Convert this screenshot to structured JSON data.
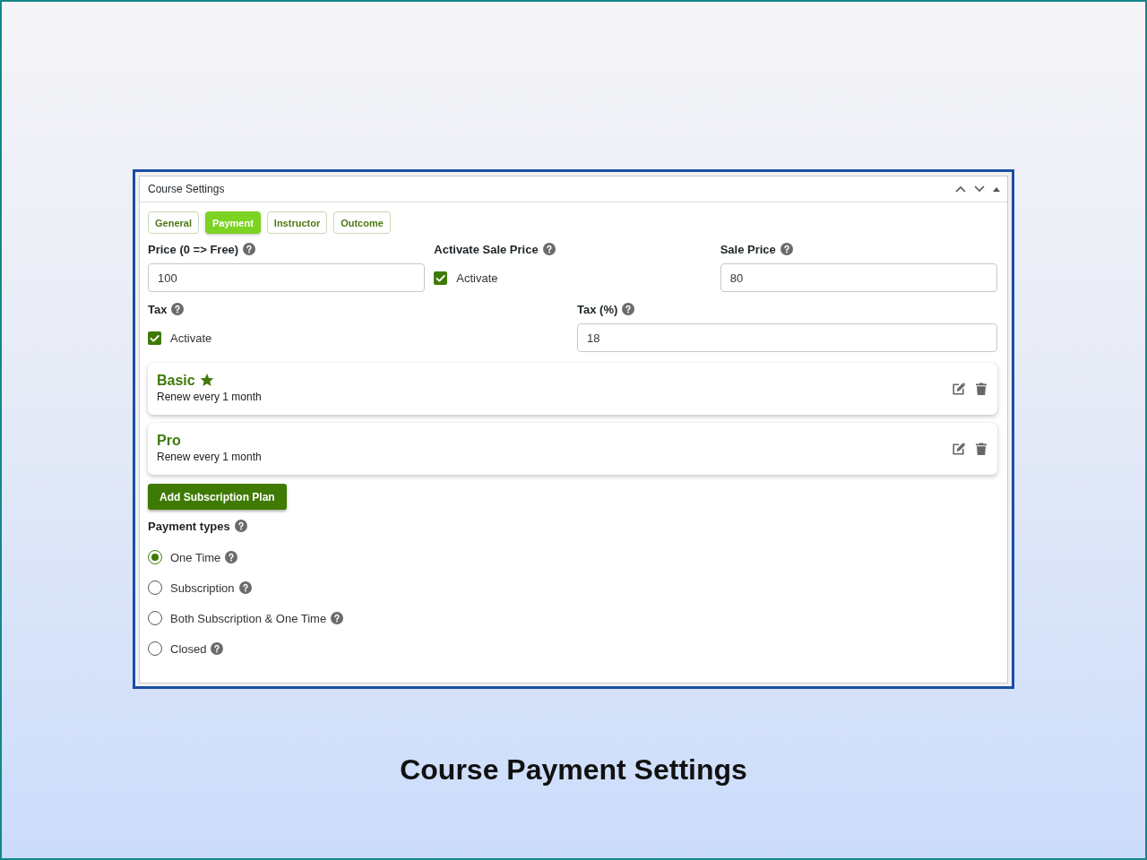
{
  "panel": {
    "title": "Course Settings"
  },
  "tabs": [
    {
      "label": "General",
      "selected": false
    },
    {
      "label": "Payment",
      "selected": true
    },
    {
      "label": "Instructor",
      "selected": false
    },
    {
      "label": "Outcome",
      "selected": false
    }
  ],
  "field_rows": [
    [
      {
        "kind": "input",
        "label": "Price (0 => Free)",
        "value": "100"
      },
      {
        "kind": "checkbox",
        "label": "Activate Sale Price",
        "option": "Activate",
        "checked": true
      },
      {
        "kind": "input",
        "label": "Sale Price",
        "value": "80"
      }
    ],
    [
      {
        "kind": "checkbox",
        "label": "Tax",
        "option": "Activate",
        "checked": true
      },
      {
        "kind": "input",
        "label": "Tax (%)",
        "value": "18"
      }
    ]
  ],
  "plans": [
    {
      "name": "Basic",
      "featured": true,
      "renewal": "Renew every 1 month"
    },
    {
      "name": "Pro",
      "featured": false,
      "renewal": "Renew every 1 month"
    }
  ],
  "add_plan_button": "Add Subscription Plan",
  "payment_types": {
    "label": "Payment types",
    "options": [
      {
        "label": "One Time",
        "selected": true
      },
      {
        "label": "Subscription",
        "selected": false
      },
      {
        "label": "Both Subscription & One Time",
        "selected": false
      },
      {
        "label": "Closed",
        "selected": false
      }
    ]
  },
  "caption": "Course Payment Settings"
}
